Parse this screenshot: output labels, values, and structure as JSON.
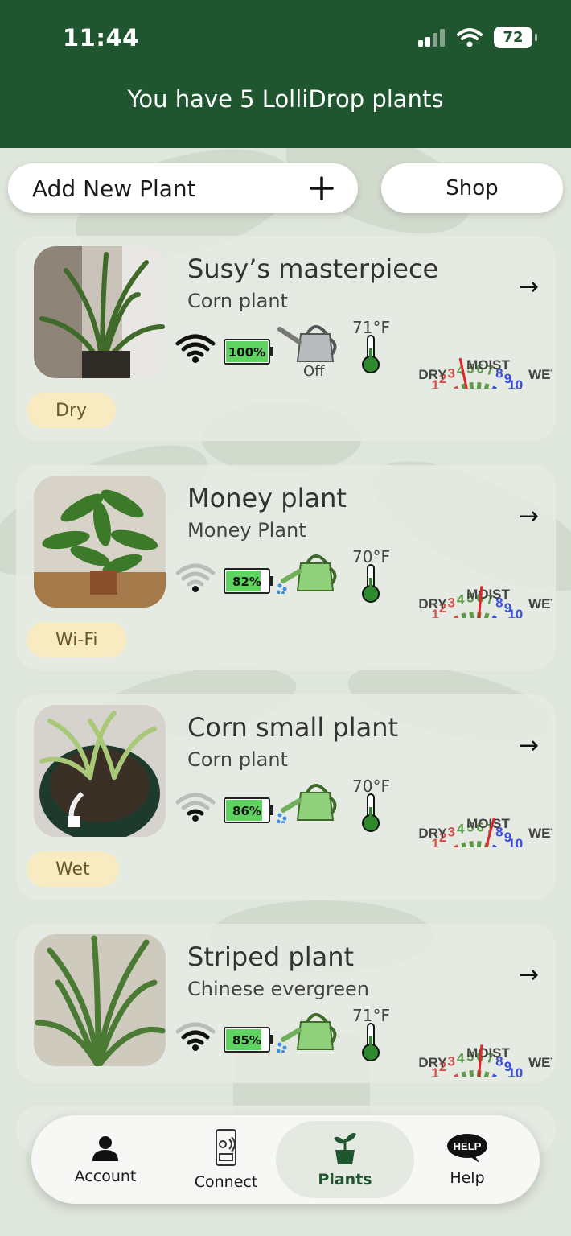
{
  "status_bar": {
    "time": "11:44",
    "battery": "72"
  },
  "header": {
    "title": "You have 5 LolliDrop plants"
  },
  "actions": {
    "add_label": "Add New Plant",
    "add_icon": "plus-icon",
    "shop_label": "Shop"
  },
  "plants": [
    {
      "name": "Susy’s masterpiece",
      "species": "Corn plant",
      "wifi": "full",
      "battery": "100%",
      "watering": "Off",
      "temperature": "71°F",
      "moisture": 4.3,
      "status": "Dry"
    },
    {
      "name": "Money plant",
      "species": "Money Plant",
      "wifi": "none",
      "battery": "82%",
      "watering": "on",
      "temperature": "70°F",
      "moisture": 6.0,
      "status": "Wi-Fi"
    },
    {
      "name": "Corn small plant",
      "species": "Corn plant",
      "wifi": "weak",
      "battery": "86%",
      "watering": "on",
      "temperature": "70°F",
      "moisture": 7.0,
      "status": "Wet"
    },
    {
      "name": "Striped plant",
      "species": "Chinese evergreen",
      "wifi": "medium",
      "battery": "85%",
      "watering": "on",
      "temperature": "71°F",
      "moisture": 6.0
    }
  ],
  "gauge": {
    "numbers": [
      "1",
      "2",
      "3",
      "4",
      "5",
      "6",
      "7",
      "8",
      "9",
      "10"
    ],
    "labels": {
      "dry": "DRY",
      "moist": "MOIST",
      "wet": "WET"
    },
    "colors": {
      "dry": "#d9504f",
      "moist": "#5f9a4a",
      "wet": "#3d4fe0",
      "needle": "#e0262a"
    }
  },
  "tabs": [
    {
      "label": "Account",
      "icon": "person-icon"
    },
    {
      "label": "Connect",
      "icon": "phone-signal-icon"
    },
    {
      "label": "Plants",
      "icon": "potted-plant-icon",
      "active": true
    },
    {
      "label": "Help",
      "icon": "help-bubble-icon"
    }
  ],
  "colors": {
    "brand": "#1f5630",
    "background": "#dfe6dc",
    "chip": "#f8ebc2"
  }
}
